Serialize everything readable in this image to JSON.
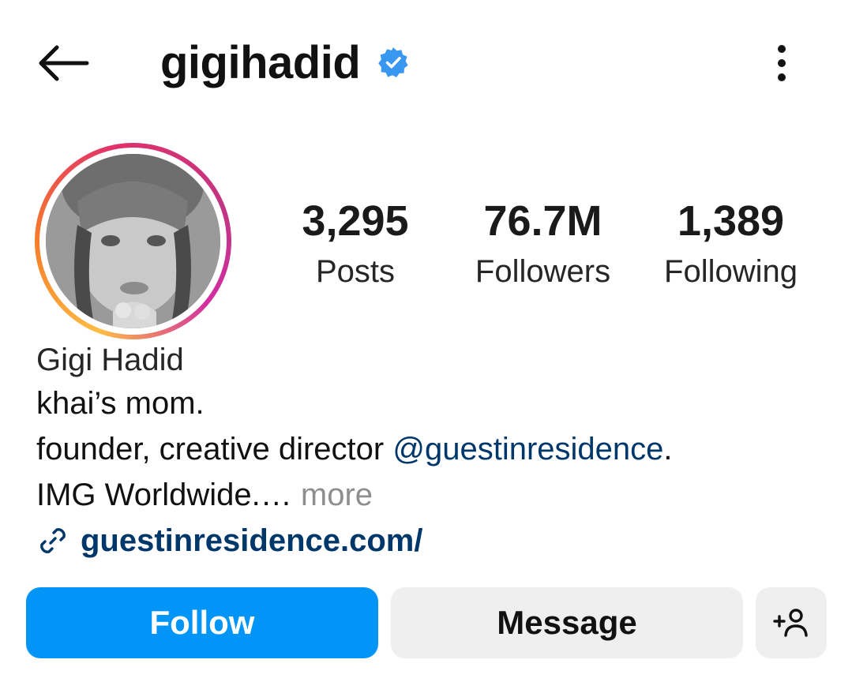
{
  "header": {
    "username": "gigihadid",
    "verified_color": "#3897f0"
  },
  "profile": {
    "display_name": "Gigi Hadid",
    "stats": {
      "posts_count": "3,295",
      "posts_label": "Posts",
      "followers_count": "76.7M",
      "followers_label": "Followers",
      "following_count": "1,389",
      "following_label": "Following"
    },
    "bio": {
      "line1": "khai’s mom.",
      "line2_text": "founder, creative director ",
      "line2_mention": "@guestinresidence",
      "line2_end": ".",
      "line3_text": "IMG Worldwide.",
      "line3_ellipsis": "… ",
      "line3_more": "more"
    },
    "link": "guestinresidence.com/"
  },
  "actions": {
    "follow_label": "Follow",
    "message_label": "Message"
  },
  "icons": {
    "back": "arrow-left-icon",
    "verified": "verified-badge-icon",
    "more": "more-vertical-icon",
    "link": "link-icon",
    "suggest": "add-person-icon"
  },
  "colors": {
    "follow_bg": "#0095f6",
    "secondary_btn_bg": "#efefef",
    "link_color": "#00376b",
    "more_text": "#8e8e8e"
  }
}
